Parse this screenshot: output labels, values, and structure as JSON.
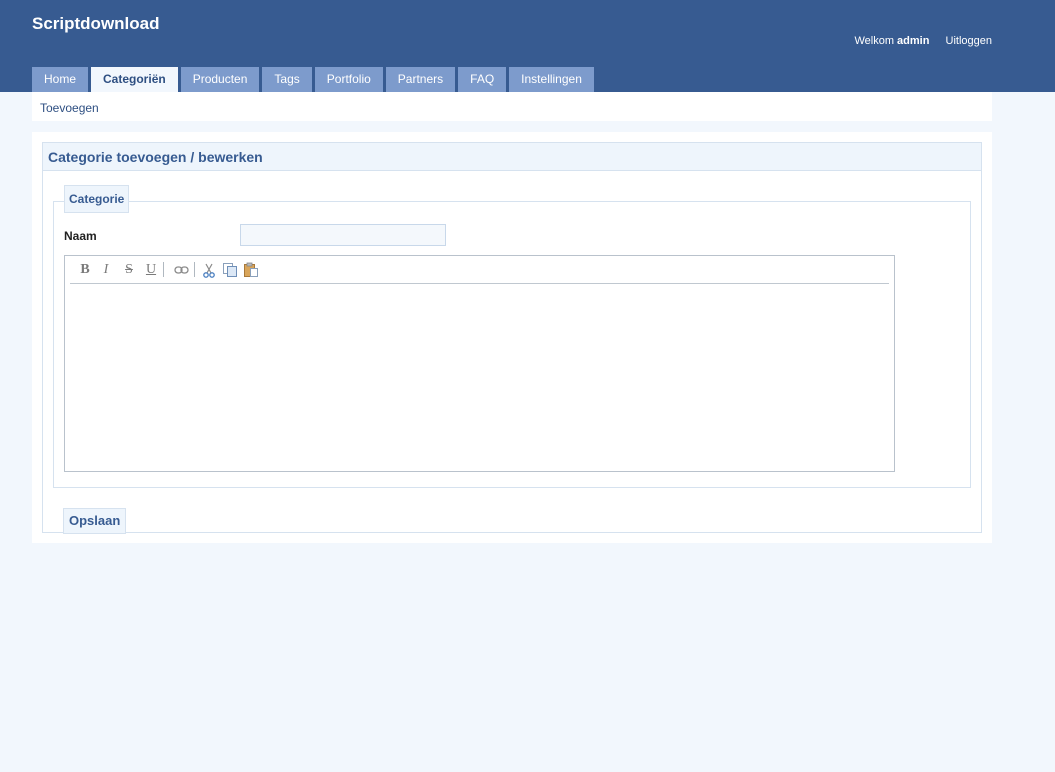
{
  "header": {
    "site_title": "Scriptdownload",
    "welcome_text": "Welkom",
    "username": "admin",
    "logout_label": "Uitloggen"
  },
  "tabs": [
    {
      "label": "Home",
      "active": false
    },
    {
      "label": "Categoriën",
      "active": true
    },
    {
      "label": "Producten",
      "active": false
    },
    {
      "label": "Tags",
      "active": false
    },
    {
      "label": "Portfolio",
      "active": false
    },
    {
      "label": "Partners",
      "active": false
    },
    {
      "label": "FAQ",
      "active": false
    },
    {
      "label": "Instellingen",
      "active": false
    }
  ],
  "subnav": {
    "add_label": "Toevoegen"
  },
  "form": {
    "title": "Categorie toevoegen / bewerken",
    "legend": "Categorie",
    "naam_label": "Naam",
    "naam_value": "",
    "save_label": "Opslaan"
  },
  "editor": {
    "toolbar_icons": [
      "bold-icon",
      "italic-icon",
      "strikethrough-icon",
      "underline-icon",
      "link-icon",
      "cut-icon",
      "copy-icon",
      "paste-icon"
    ],
    "content": ""
  },
  "colors": {
    "header_bg": "#375b91",
    "tab_bg": "#7d9bcc",
    "page_bg": "#f2f7fd",
    "accent_text": "#375b91"
  }
}
